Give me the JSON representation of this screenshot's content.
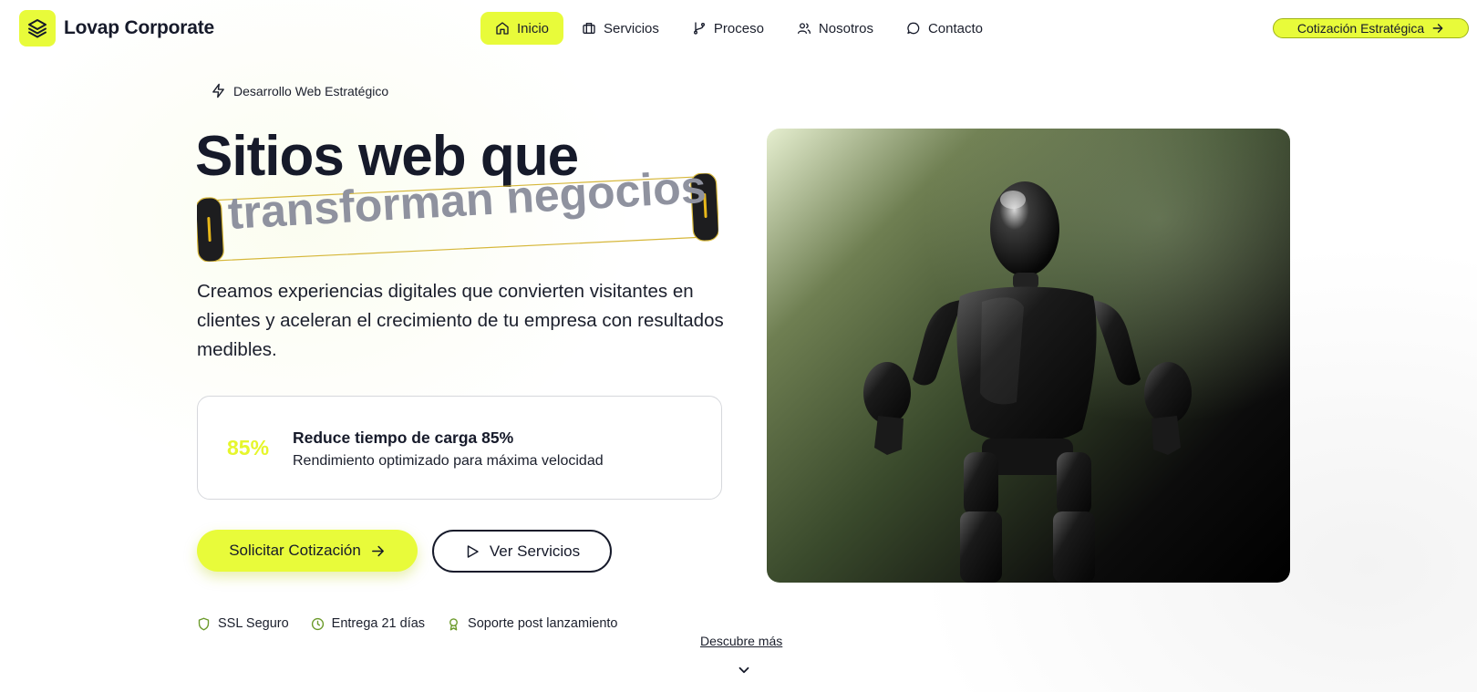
{
  "header": {
    "brand_name": "Lovap Corporate",
    "cta_label": "Cotización Estratégica"
  },
  "nav": [
    {
      "label": "Inicio",
      "icon": "home-icon",
      "active": true
    },
    {
      "label": "Servicios",
      "icon": "briefcase-icon",
      "active": false
    },
    {
      "label": "Proceso",
      "icon": "git-branch-icon",
      "active": false
    },
    {
      "label": "Nosotros",
      "icon": "users-icon",
      "active": false
    },
    {
      "label": "Contacto",
      "icon": "chat-bubble-icon",
      "active": false
    }
  ],
  "hero": {
    "eyebrow": "Desarrollo Web Estratégico",
    "title_line1": "Sitios web que",
    "title_highlight": "transforman negocios",
    "lead": "Creamos experiencias digitales que convierten visitantes en clientes y aceleran el crecimiento de tu empresa con resultados medibles.",
    "stat": {
      "number": "85%",
      "title": "Reduce tiempo de carga 85%",
      "subtitle": "Rendimiento optimizado para máxima velocidad"
    },
    "primary_button": "Solicitar Cotización",
    "secondary_button": "Ver Servicios",
    "trust": [
      {
        "label": "SSL Seguro",
        "icon": "shield-icon"
      },
      {
        "label": "Entrega 21 días",
        "icon": "clock-icon"
      },
      {
        "label": "Soporte post lanzamiento",
        "icon": "award-icon"
      }
    ],
    "discover": "Descubre más"
  },
  "colors": {
    "accent": "#e8fb3a",
    "dark": "#161a2a",
    "muted_heading": "#8f929f",
    "trust_icon": "#6b9a2a"
  }
}
